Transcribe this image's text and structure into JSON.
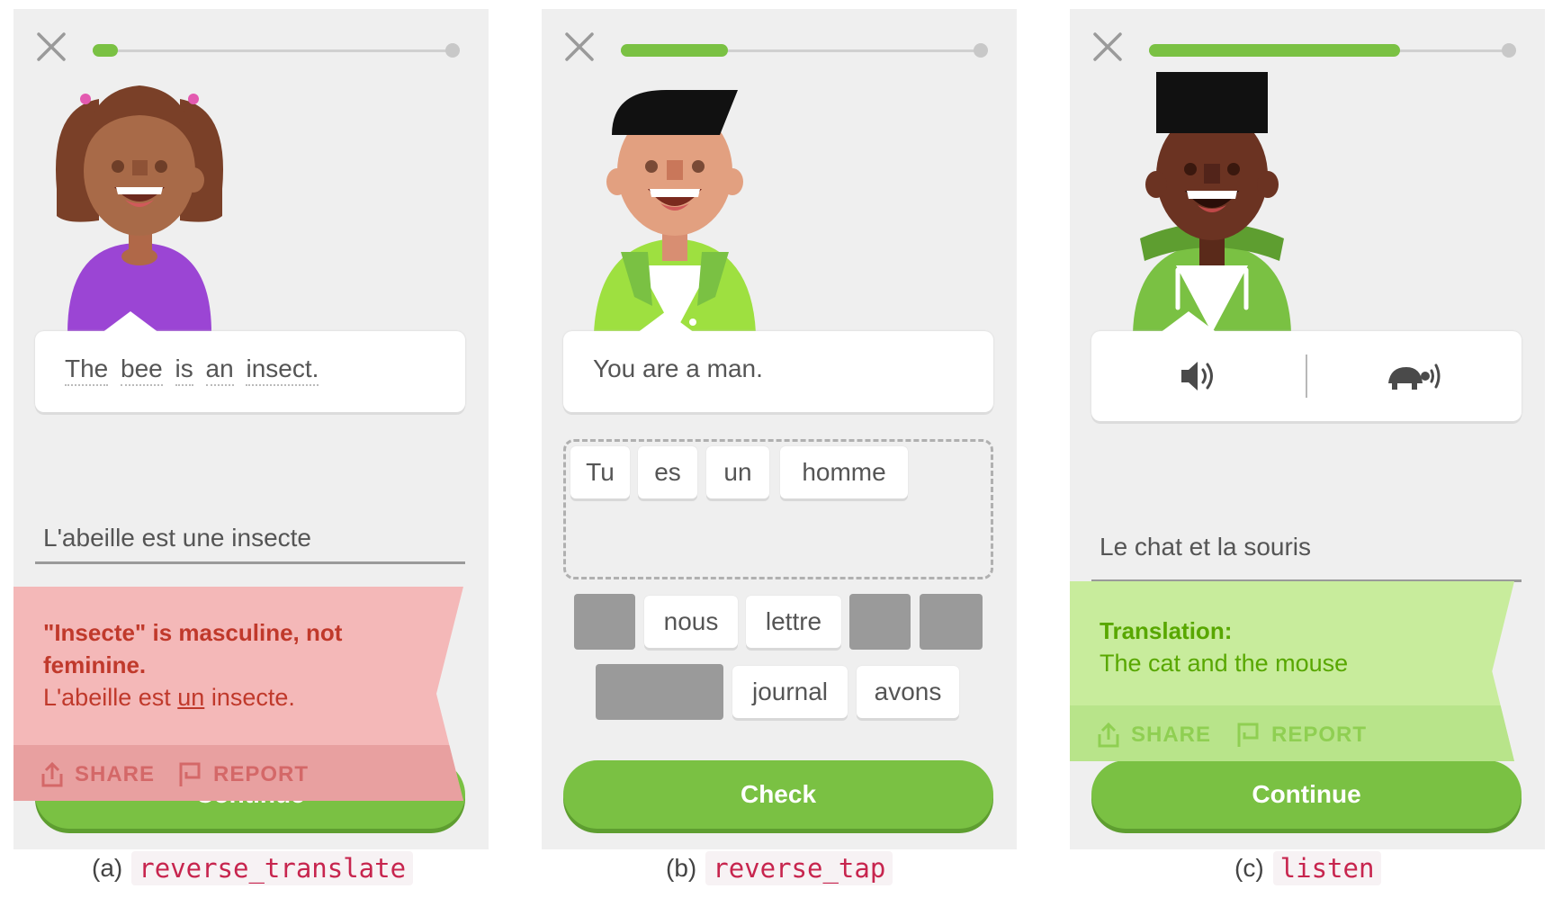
{
  "colors": {
    "accent_green": "#7ac143",
    "error_red_text": "#c0392b",
    "error_bg": "#f4b8b8",
    "success_bg": "#c8ec9c",
    "success_text": "#58a700"
  },
  "panel_a": {
    "progress": 0.07,
    "prompt_words": [
      "The",
      "bee",
      "is",
      "an",
      "insect."
    ],
    "answer": "L'abeille est une insecte",
    "feedback": {
      "title_line1": "\"Insecte\" is masculine, not",
      "title_line2": "feminine.",
      "correction_before": "L'abeille est ",
      "correction_highlight": "un",
      "correction_after": " insecte.",
      "share_label": "SHARE",
      "report_label": "REPORT"
    },
    "button_label": "Continue",
    "caption_letter": "(a)",
    "caption_code": "reverse_translate"
  },
  "panel_b": {
    "progress": 0.3,
    "prompt": "You are a man.",
    "selected_words": [
      "Tu",
      "es",
      "un",
      "homme"
    ],
    "bank_row1": [
      "nous",
      "lettre"
    ],
    "bank_row2": [
      "journal",
      "avons"
    ],
    "button_label": "Check",
    "caption_letter": "(b)",
    "caption_code": "reverse_tap"
  },
  "panel_c": {
    "progress": 0.7,
    "play_icon": "speaker-icon",
    "slow_icon": "turtle-icon",
    "answer": "Le chat et la souris",
    "feedback": {
      "title": "Translation:",
      "text": "The cat and the mouse",
      "share_label": "SHARE",
      "report_label": "REPORT"
    },
    "button_label": "Continue",
    "caption_letter": "(c)",
    "caption_code": "listen"
  }
}
